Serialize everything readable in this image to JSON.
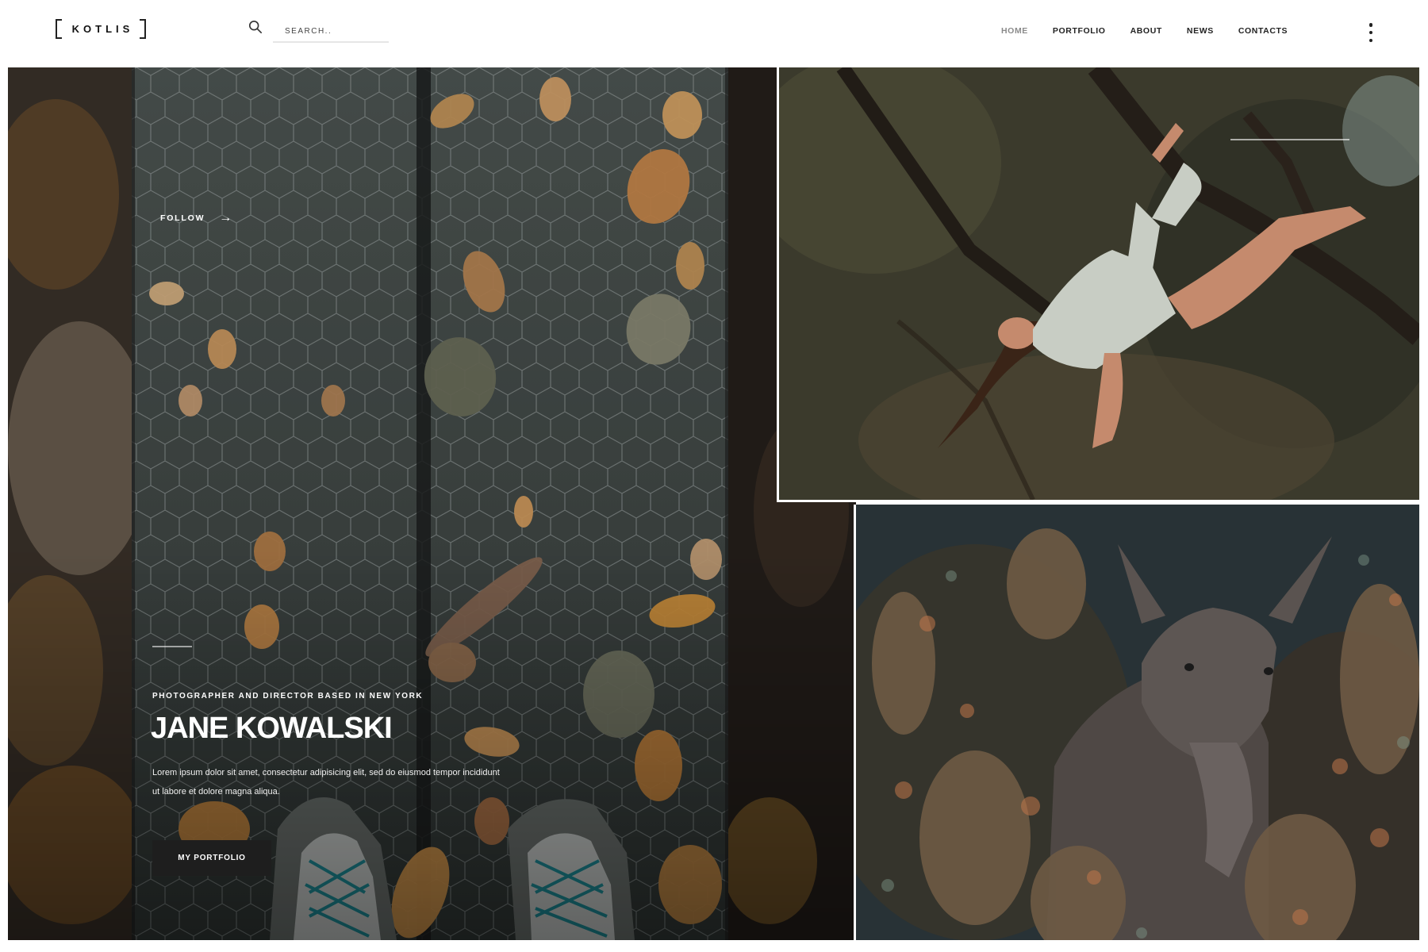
{
  "header": {
    "logo_text": "KOTLIS",
    "search": {
      "placeholder": "SEARCH..",
      "value": ""
    },
    "nav": [
      {
        "label": "HOME",
        "active": true
      },
      {
        "label": "PORTFOLIO",
        "active": false
      },
      {
        "label": "ABOUT",
        "active": false
      },
      {
        "label": "NEWS",
        "active": false
      },
      {
        "label": "CONTACTS",
        "active": false
      }
    ],
    "menu_icon": "vertical-dots-icon"
  },
  "hero": {
    "follow_label": "FOLLOW",
    "follow_icon": "arrow-right-icon",
    "tagline": "PHOTOGRAPHER AND DIRECTOR BASED IN NEW YORK",
    "name": "JANE KOWALSKI",
    "description": "Lorem ipsum dolor sit amet, consectetur adipisicing elit, sed do eiusmod tempor incididunt ut labore et dolore magna aliqua.",
    "cta_label": "MY PORTFOLIO",
    "photo_subject": "boardwalk-with-autumn-leaves-and-hiking-boots"
  },
  "gallery": [
    {
      "photo_subject": "woman-hanging-from-tree-branch-in-forest"
    },
    {
      "photo_subject": "moose-in-autumn-bushes"
    }
  ],
  "colors": {
    "accent_dark": "#1e1e1e",
    "nav_active": "#8a8a8a",
    "nav_text": "#222222",
    "page_bg": "#ffffff"
  }
}
